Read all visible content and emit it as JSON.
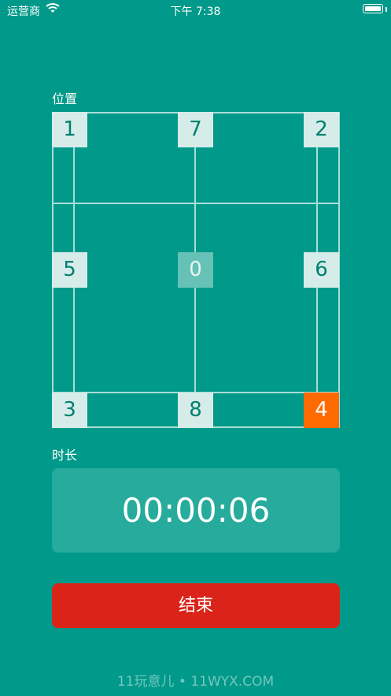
{
  "status_bar": {
    "carrier": "运营商",
    "time": "下午 7:38"
  },
  "position_section": {
    "label": "位置"
  },
  "tiles": [
    "1",
    "7",
    "2",
    "5",
    "0",
    "6",
    "3",
    "8",
    "4"
  ],
  "active_tile": "4",
  "duration_section": {
    "label": "时长",
    "value": "00:00:06"
  },
  "end_button": {
    "label": "结束"
  },
  "watermark": "11玩意儿 • 11WYX.COM",
  "colors": {
    "background": "#00998a",
    "tile": "#d6ece9",
    "active_tile": "#ff6a00",
    "end_button": "#db2419"
  },
  "icons": [
    "wifi-icon",
    "battery-icon"
  ]
}
